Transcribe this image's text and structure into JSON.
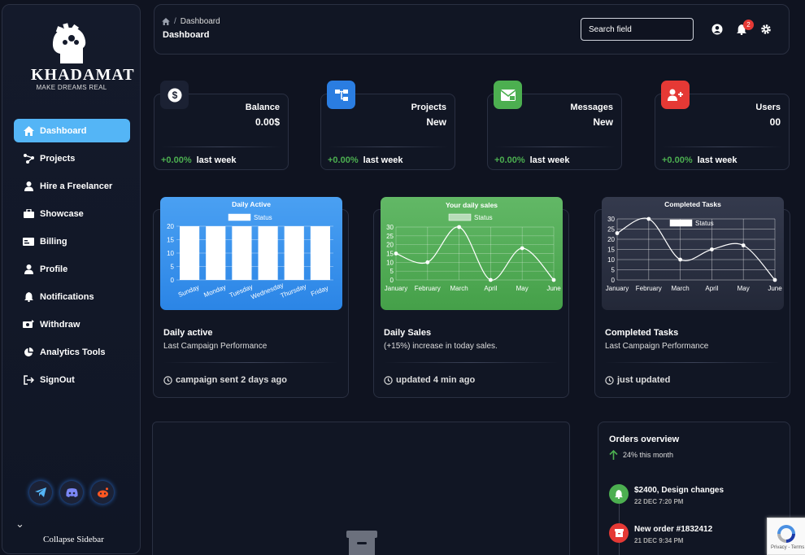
{
  "brand": {
    "name": "KHADAMAT",
    "tagline": "MAKE DREAMS REAL"
  },
  "sidebar": {
    "items": [
      {
        "label": "Dashboard",
        "icon": "home-icon",
        "active": true
      },
      {
        "label": "Projects",
        "icon": "share-nodes-icon"
      },
      {
        "label": "Hire a Freelancer",
        "icon": "user-tie-icon"
      },
      {
        "label": "Showcase",
        "icon": "briefcase-icon"
      },
      {
        "label": "Billing",
        "icon": "money-bill-icon"
      },
      {
        "label": "Profile",
        "icon": "user-icon"
      },
      {
        "label": "Notifications",
        "icon": "bell-icon"
      },
      {
        "label": "Withdraw",
        "icon": "money-transfer-icon"
      },
      {
        "label": "Analytics Tools",
        "icon": "pie-chart-icon"
      },
      {
        "label": "SignOut",
        "icon": "sign-out-icon"
      }
    ],
    "socials": [
      "telegram-icon",
      "discord-icon",
      "reddit-icon"
    ],
    "collapse_label": "Collapse Sidebar"
  },
  "header": {
    "breadcrumb": "Dashboard",
    "title": "Dashboard",
    "search_placeholder": "Search field",
    "notification_count": "2"
  },
  "stats": [
    {
      "label": "Balance",
      "value": "0.00$",
      "change": "+0.00%",
      "period": "last week",
      "icon": "dollar-icon",
      "color": "#1b2133"
    },
    {
      "label": "Projects",
      "value": "New",
      "change": "+0.00%",
      "period": "last week",
      "icon": "sitemap-icon",
      "color": "#2a7de1"
    },
    {
      "label": "Messages",
      "value": "New",
      "change": "+0.00%",
      "period": "last week",
      "icon": "envelope-icon",
      "color": "#4caf50"
    },
    {
      "label": "Users",
      "value": "00",
      "change": "+0.00%",
      "period": "last week",
      "icon": "user-plus-icon",
      "color": "#e53935"
    }
  ],
  "chart_cards": [
    {
      "title": "Daily active",
      "subtitle": "Last Campaign Performance",
      "footer": "campaign sent 2 days ago"
    },
    {
      "title": "Daily Sales",
      "subtitle": "(+15%) increase in today sales.",
      "footer": "updated 4 min ago"
    },
    {
      "title": "Completed Tasks",
      "subtitle": "Last Campaign Performance",
      "footer": "just updated"
    }
  ],
  "chart_data": [
    {
      "type": "bar",
      "title": "Daily Active",
      "legend": "Status",
      "categories": [
        "Sunday",
        "Monday",
        "Tuesday",
        "Wednesday",
        "Thursday",
        "Friday"
      ],
      "values": [
        20,
        20,
        20,
        20,
        20,
        20
      ],
      "ylim": [
        0,
        20
      ],
      "yticks": [
        "20",
        "15",
        "10",
        "5",
        "0"
      ]
    },
    {
      "type": "line",
      "title": "Your daily sales",
      "legend": "Status",
      "categories": [
        "January",
        "February",
        "March",
        "April",
        "May",
        "June"
      ],
      "values": [
        15,
        10,
        30,
        0,
        18,
        0
      ],
      "ylim": [
        0,
        30
      ],
      "yticks": [
        "30",
        "25",
        "20",
        "15",
        "10",
        "5",
        "0"
      ]
    },
    {
      "type": "line",
      "title": "Completed Tasks",
      "legend": "Status",
      "categories": [
        "January",
        "February",
        "March",
        "April",
        "May",
        "June"
      ],
      "values": [
        23,
        30,
        10,
        15,
        17,
        0
      ],
      "ylim": [
        0,
        30
      ],
      "yticks": [
        "30",
        "25",
        "20",
        "15",
        "10",
        "5",
        "0"
      ]
    }
  ],
  "orders": {
    "title": "Orders overview",
    "subtitle": "24% this month",
    "items": [
      {
        "name": "$2400, Design changes",
        "date": "22 DEC 7:20 PM",
        "icon": "bell-icon",
        "color": "#4caf50"
      },
      {
        "name": "New order #1832412",
        "date": "21 DEC 9:34 PM",
        "icon": "box-icon",
        "color": "#e53935"
      }
    ]
  },
  "recaptcha": {
    "text": "Privacy - Terms"
  }
}
